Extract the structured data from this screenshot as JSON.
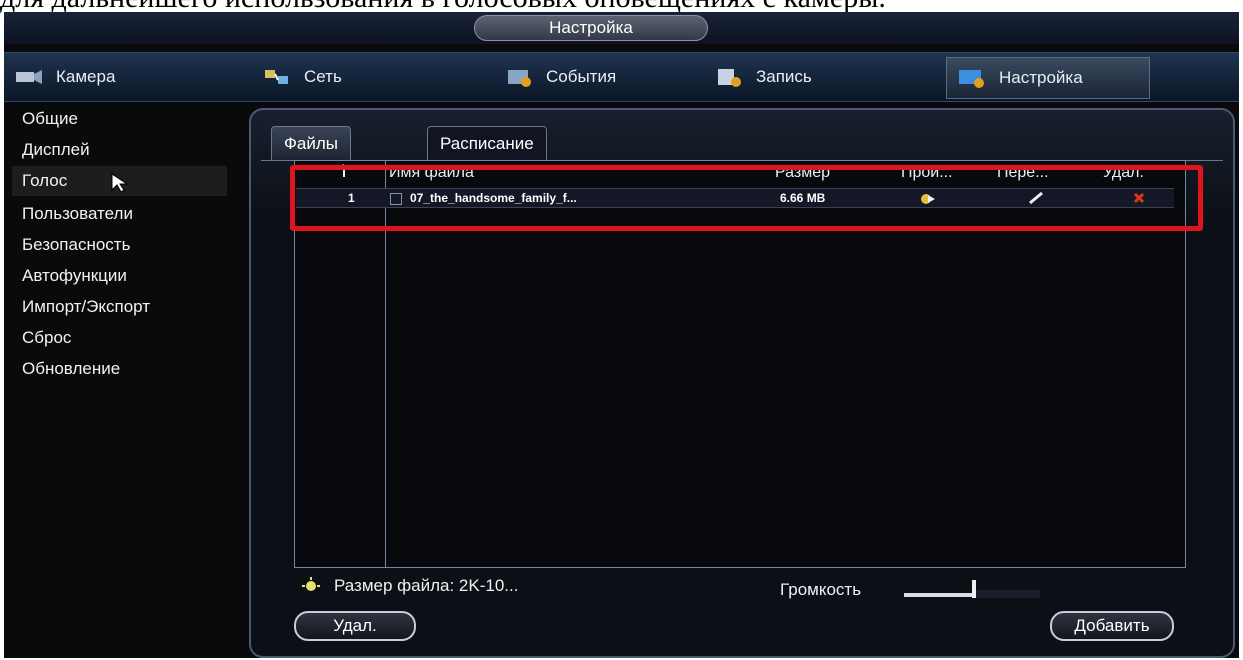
{
  "document": {
    "caption": "для дальнейшего использования в голосовых оповещениях с камеры."
  },
  "window": {
    "title": "Настройка"
  },
  "topnav": {
    "items": [
      {
        "label": "Камера",
        "icon": "camera-icon"
      },
      {
        "label": "Сеть",
        "icon": "network-icon"
      },
      {
        "label": "События",
        "icon": "events-icon"
      },
      {
        "label": "Запись",
        "icon": "record-icon"
      },
      {
        "label": "Настройка",
        "icon": "settings-icon",
        "active": true
      }
    ]
  },
  "sidebar": {
    "items": [
      {
        "label": "Общие"
      },
      {
        "label": "Дисплей"
      },
      {
        "label": "Голос",
        "active": true
      },
      {
        "label": "Пользователи"
      },
      {
        "label": "Безопасность"
      },
      {
        "label": "Автофункции"
      },
      {
        "label": "Импорт/Экспорт"
      },
      {
        "label": "Сброс"
      },
      {
        "label": "Обновление"
      }
    ]
  },
  "tabs": [
    {
      "label": "Файлы",
      "active": true
    },
    {
      "label": "Расписание",
      "active": false
    }
  ],
  "table": {
    "headers": [
      "Имя файла",
      "Размер",
      "Прои...",
      "Пере...",
      "Удал."
    ],
    "rows": [
      {
        "num": "1",
        "name": "07_the_handsome_family_f...",
        "size": "6.66 MB"
      }
    ]
  },
  "footer": {
    "file_size_note": "Размер файла: 2K-10...",
    "volume_label": "Громкость",
    "volume_level": 0.5,
    "delete_label": "Удал.",
    "add_label": "Добавить"
  },
  "colors": {
    "highlight": "#e0141c",
    "accent": "#5a6a82"
  }
}
